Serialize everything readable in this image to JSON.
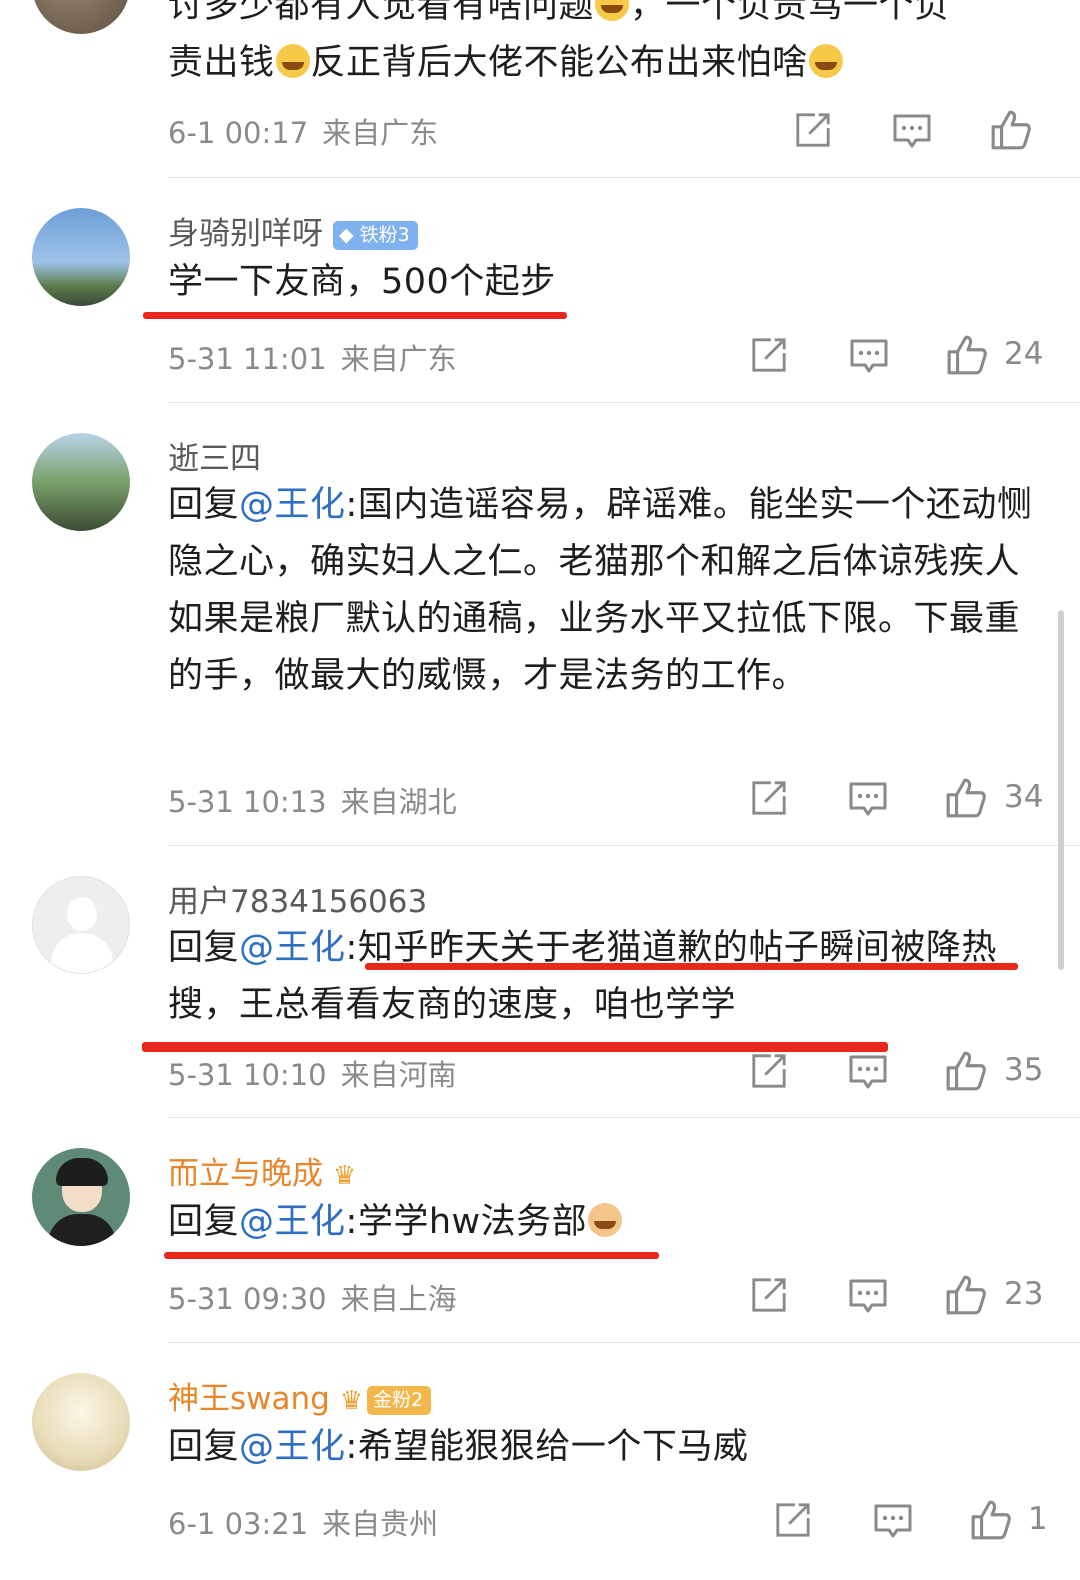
{
  "comments": [
    {
      "text_line1": "讨多少都有人觉看有啥问题",
      "text_line1b": "，一个负责骂一个负",
      "text_line2a": "责出钱",
      "text_line2b": "反正背后大佬不能公布出来怕啥",
      "date": "6-1 00:17",
      "location": "来自广东"
    },
    {
      "username": "身骑别咩呀",
      "badge": "铁粉3",
      "text": "学一下友商，500个起步",
      "date": "5-31 11:01",
      "location": "来自广东",
      "likes": "24"
    },
    {
      "username": "逝三四",
      "reply_prefix": "回复",
      "mention": "@王化",
      "text": ":国内造谣容易，辟谣难。能坐实一个还动恻隐之心，确实妇人之仁。老猫那个和解之后体谅残疾人如果是粮厂默认的通稿，业务水平又拉低下限。下最重的手，做最大的威慑，才是法务的工作。",
      "date": "5-31 10:13",
      "location": "来自湖北",
      "likes": "34"
    },
    {
      "username": "用户7834156063",
      "reply_prefix": "回复",
      "mention": "@王化",
      "text": ":知乎昨天关于老猫道歉的帖子瞬间被降热搜，王总看看友商的速度，咱也学学",
      "date": "5-31 10:10",
      "location": "来自河南",
      "likes": "35"
    },
    {
      "username": "而立与晚成",
      "reply_prefix": "回复",
      "mention": "@王化",
      "text": ":学学hw法务部",
      "date": "5-31 09:30",
      "location": "来自上海",
      "likes": "23"
    },
    {
      "username": "神王swang",
      "badge": "金粉2",
      "reply_prefix": "回复",
      "mention": "@王化",
      "text": ":希望能狠狠给一个下马威",
      "date": "6-1 03:21",
      "location": "来自贵州",
      "likes": "1"
    }
  ],
  "colors": {
    "accent_link": "#2f6fc2",
    "underline_red": "#e8281c",
    "gold_username": "#e8862a"
  },
  "icons": [
    "share-icon",
    "comment-icon",
    "like-icon",
    "crown-icon"
  ]
}
